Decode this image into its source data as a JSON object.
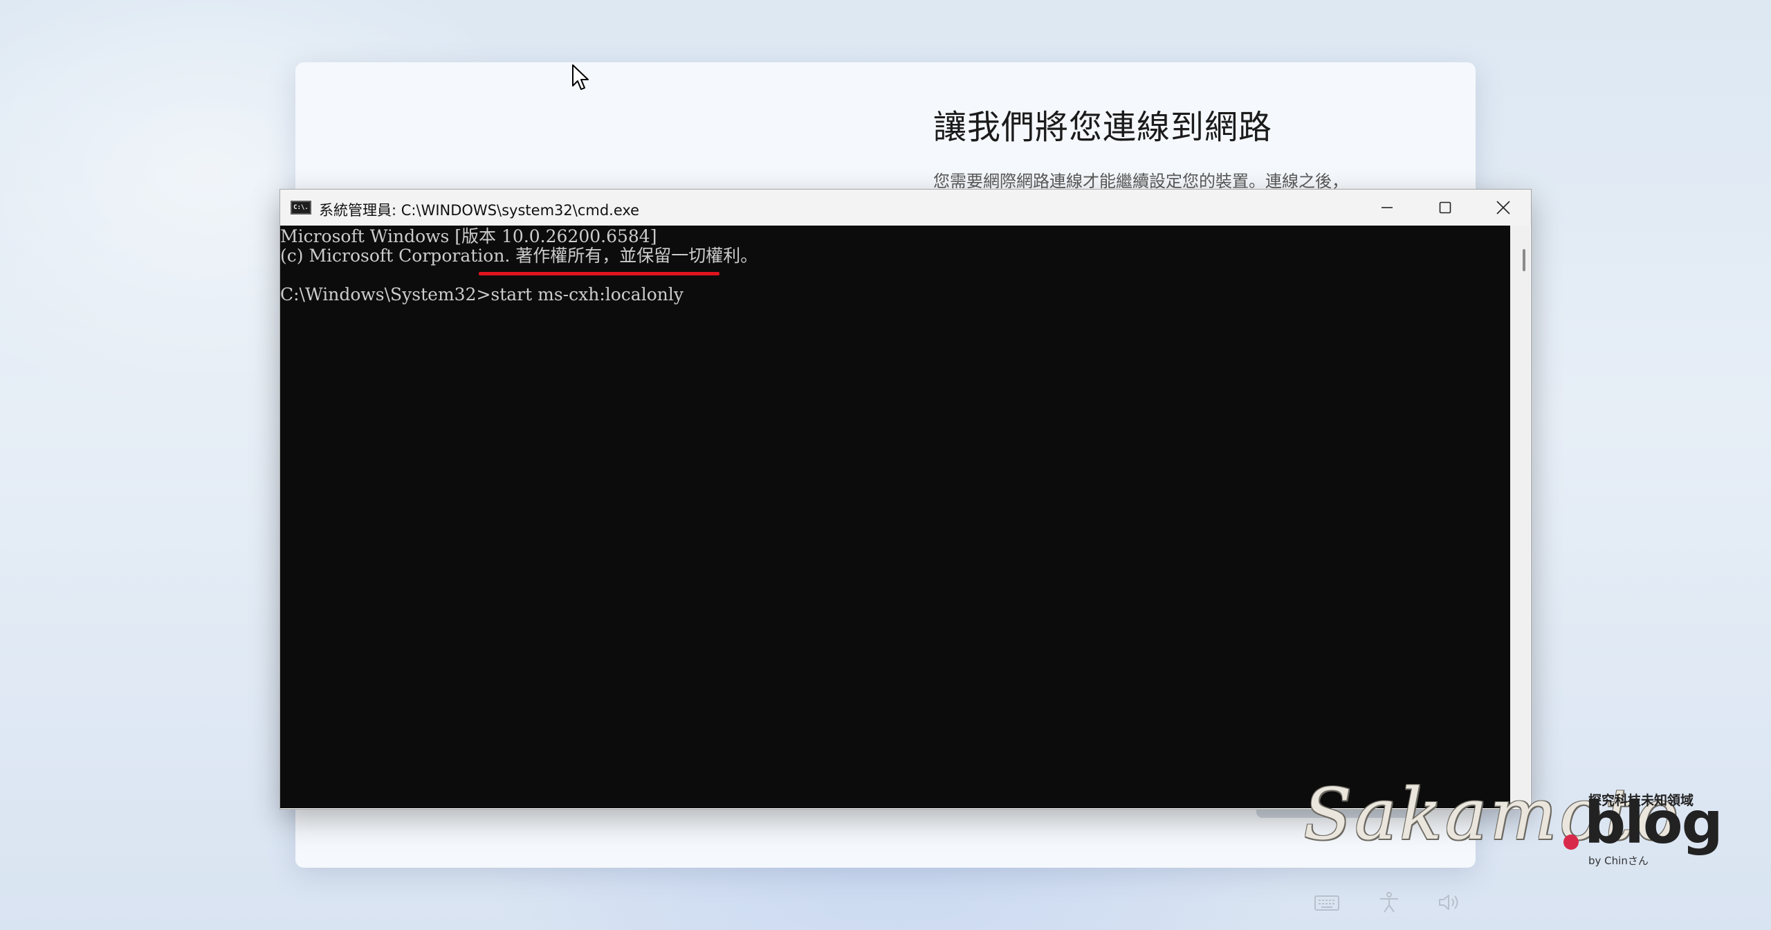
{
  "oobe": {
    "title": "讓我們將您連線到網路",
    "description": "您需要網際網路連線才能繼續設定您的裝置。連線之後，"
  },
  "cmd_window": {
    "title": "系統管理員: C:\\WINDOWS\\system32\\cmd.exe",
    "icon_text": "C:\\.",
    "controls": {
      "minimize": "minimize",
      "maximize": "maximize",
      "close": "close"
    },
    "console_lines": [
      "Microsoft Windows [版本 10.0.26200.6584]",
      "(c) Microsoft Corporation. 著作權所有，並保留一切權利。",
      "C:\\Windows\\System32>start ms-cxh:localonly"
    ],
    "highlight_color": "#e0141e"
  },
  "system_icons": [
    "keyboard-icon",
    "accessibility-icon",
    "volume-icon"
  ],
  "watermark": {
    "brand": "Sakamoto",
    "suffix": "blog",
    "tagline": "探究科技未知領域",
    "byline": "by Chinさん",
    "dot_color": "#d8294b"
  }
}
